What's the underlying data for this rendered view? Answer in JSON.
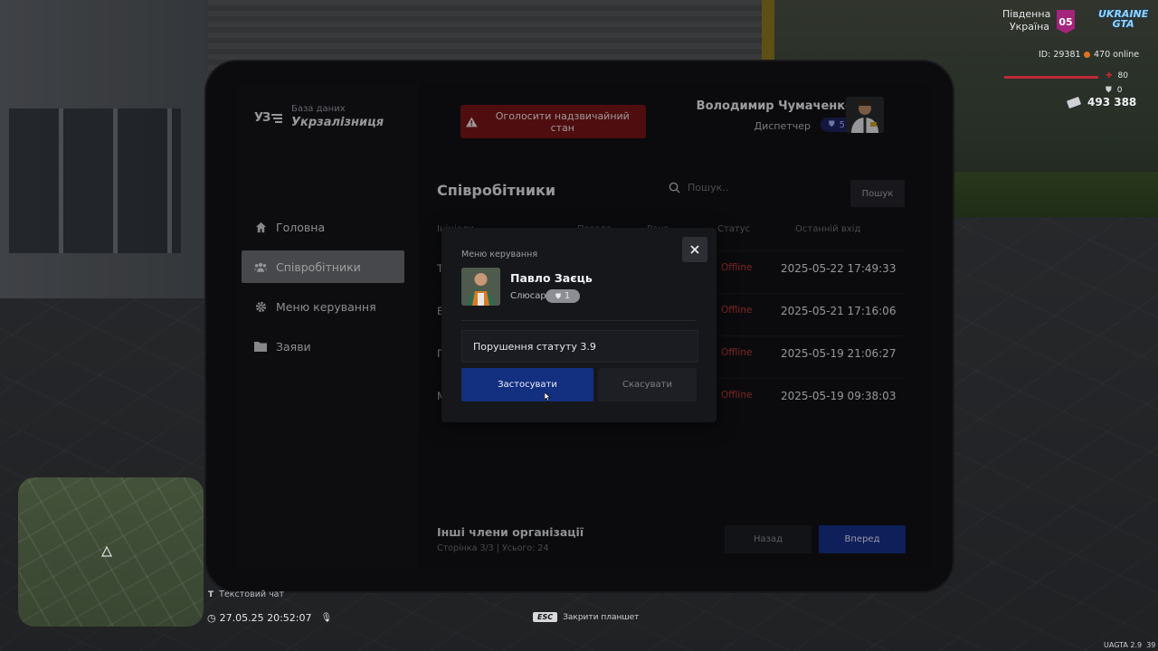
{
  "hud": {
    "server_name_line1": "Південна",
    "server_name_line2": "Україна",
    "server_number": "05",
    "logo_line1": "UKRAINE",
    "logo_line2": "GTA",
    "player_id": "ID: 29381",
    "online": "470 online",
    "health": "80",
    "armor": "0",
    "money": "493 388",
    "chat_hint": "Текстовий чат",
    "datetime": "27.05.25 20:52:07",
    "esc_key": "ESC",
    "esc_hint": "Закрити планшет",
    "version": "UAGTA 2.9",
    "version_cut": "39"
  },
  "app": {
    "logo_mark": "УЗ",
    "subtitle": "База даних",
    "title": "Укрзалізниця",
    "alarm_label": "Оголосити надзвичайний стан",
    "user": {
      "name": "Володимир Чумаченко",
      "role": "Диспетчер",
      "rank": "5"
    }
  },
  "sidebar": {
    "items": [
      {
        "label": "Головна",
        "icon": "home-icon",
        "active": false
      },
      {
        "label": "Співробітники",
        "icon": "users-icon",
        "active": true
      },
      {
        "label": "Меню керування",
        "icon": "gear-icon",
        "active": false
      },
      {
        "label": "Заяви",
        "icon": "folder-icon",
        "active": false
      }
    ]
  },
  "main": {
    "title": "Співробітники",
    "search_placeholder": "Пошук..",
    "search_button": "Пошук",
    "columns": [
      "Ініціали",
      "Посада",
      "Ранг",
      "Статус",
      "Останній вхід"
    ],
    "rows": [
      {
        "initial": "Т",
        "status": "Offline",
        "last_login": "2025-05-22 17:49:33"
      },
      {
        "initial": "Б",
        "status": "Offline",
        "last_login": "2025-05-21 17:16:06"
      },
      {
        "initial": "П",
        "status": "Offline",
        "last_login": "2025-05-19 21:06:27"
      },
      {
        "initial": "М",
        "status": "Offline",
        "last_login": "2025-05-19 09:38:03"
      }
    ],
    "others_title": "Інші члени організації",
    "pagination": "Сторінка 3/3 | Усього: 24",
    "back_label": "Назад",
    "next_label": "Вперед"
  },
  "modal": {
    "title": "Меню керування",
    "employee_name": "Павло Заєць",
    "employee_role": "Слюсар",
    "employee_rank": "1",
    "reason_value": "Порушення статуту 3.9",
    "apply_label": "Застосувати",
    "cancel_label": "Скасувати"
  },
  "colors": {
    "accent_blue": "#132f80",
    "alarm_red": "#7a1517",
    "offline_red": "#c53a3a"
  }
}
